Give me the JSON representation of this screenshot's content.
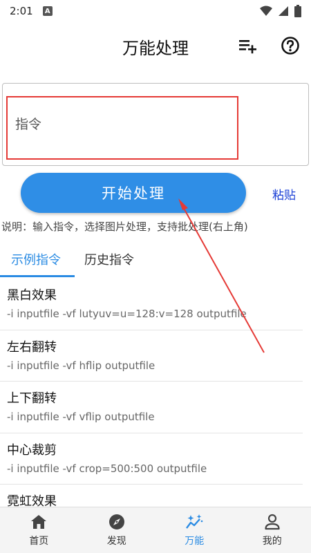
{
  "status": {
    "time": "2:01",
    "a_badge": "A"
  },
  "header": {
    "title": "万能处理",
    "add_icon": "playlist-add-icon",
    "help_icon": "help-circle-icon"
  },
  "command": {
    "placeholder": "指令",
    "value": ""
  },
  "actions": {
    "start_label": "开始处理",
    "paste_label": "粘贴"
  },
  "description": "说明：输入指令，选择图片处理，支持批处理(右上角)",
  "tabs": [
    {
      "label": "示例指令",
      "active": true
    },
    {
      "label": "历史指令",
      "active": false
    }
  ],
  "examples": [
    {
      "title": "黑白效果",
      "cmd": "-i inputfile -vf lutyuv=u=128:v=128 outputfile"
    },
    {
      "title": "左右翻转",
      "cmd": "-i inputfile -vf hflip outputfile"
    },
    {
      "title": "上下翻转",
      "cmd": "-i inputfile -vf vflip outputfile"
    },
    {
      "title": "中心裁剪",
      "cmd": "-i inputfile -vf crop=500:500 outputfile"
    },
    {
      "title": "霓虹效果",
      "cmd": ""
    }
  ],
  "nav": [
    {
      "label": "首页",
      "icon": "home-icon",
      "active": false
    },
    {
      "label": "发现",
      "icon": "compass-icon",
      "active": false
    },
    {
      "label": "万能",
      "icon": "sparkle-chart-icon",
      "active": true
    },
    {
      "label": "我的",
      "icon": "person-icon",
      "active": false
    }
  ],
  "colors": {
    "accent": "#2a8be3",
    "button": "#2f8ee6",
    "highlight": "#e53935",
    "link": "#1a3fd6"
  }
}
